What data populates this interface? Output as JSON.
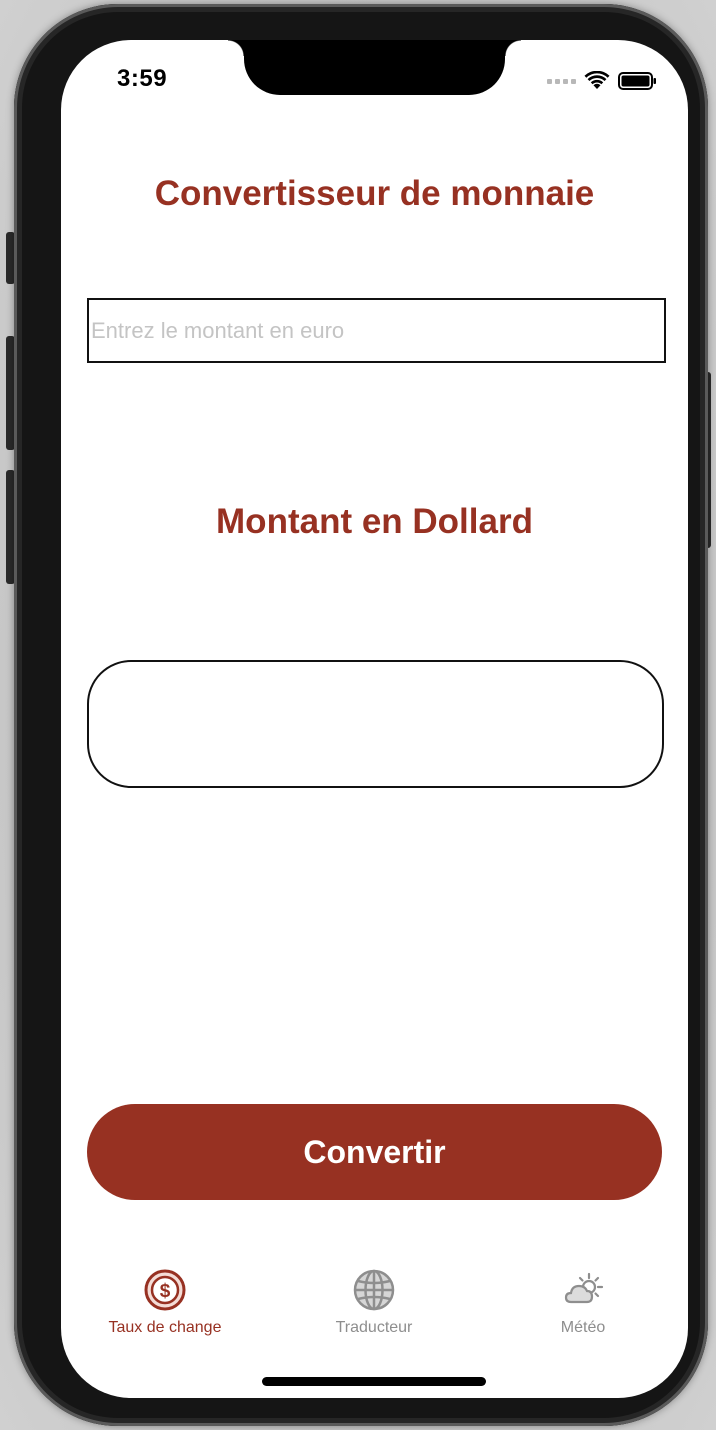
{
  "status_bar": {
    "time": "3:59"
  },
  "converter": {
    "title": "Convertisseur de monnaie",
    "euro_input_value": "",
    "euro_input_placeholder": "Entrez le montant en euro",
    "result_title": "Montant en Dollard",
    "result_value": "",
    "convert_button_label": "Convertir"
  },
  "tab_bar": {
    "items": [
      {
        "label": "Taux de change",
        "icon": "dollar-circle-icon",
        "active": true
      },
      {
        "label": "Traducteur",
        "icon": "globe-icon",
        "active": false
      },
      {
        "label": "Météo",
        "icon": "cloud-sun-icon",
        "active": false
      }
    ]
  },
  "colors": {
    "accent": "#973122",
    "tab_inactive": "#8e8e8e",
    "background": "#ffffff"
  }
}
